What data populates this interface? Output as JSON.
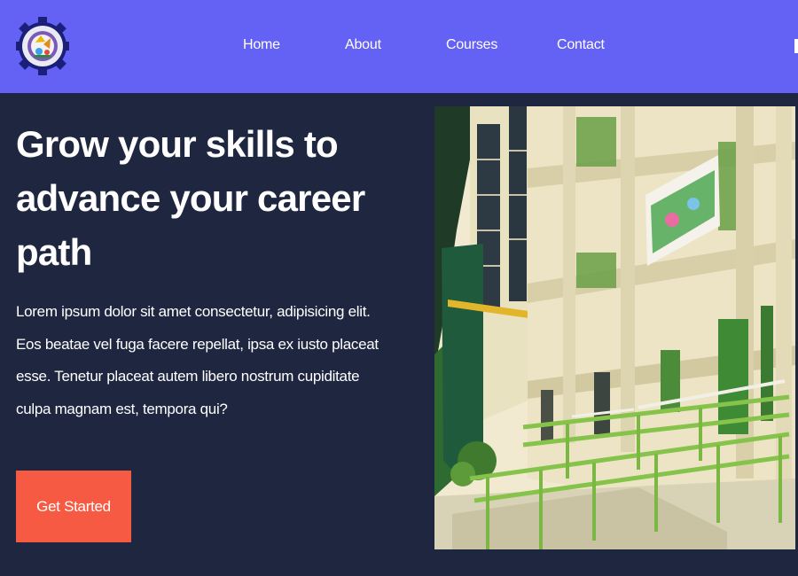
{
  "nav": {
    "links": [
      "Home",
      "About",
      "Courses",
      "Contact"
    ]
  },
  "hero": {
    "title": "Grow your skills to advance your career path",
    "description": "Lorem ipsum dolor sit amet consectetur, adipisicing elit. Eos beatae vel fuga facere repellat, ipsa ex iusto placeat esse. Tenetur placeat autem libero nostrum cupiditate culpa magnam est, tempora qui?",
    "cta_label": "Get Started"
  },
  "colors": {
    "navbar": "#6461f5",
    "page_background": "#1f2640",
    "cta": "#f75a43",
    "text": "#ffffff"
  },
  "icons": {
    "logo": "school-seal-gear-logo"
  }
}
